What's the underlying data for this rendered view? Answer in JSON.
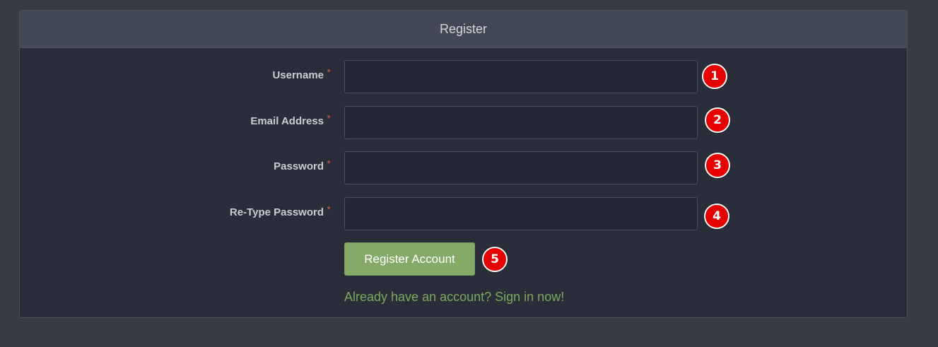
{
  "panel": {
    "title": "Register"
  },
  "form": {
    "fields": [
      {
        "label": "Username",
        "required_mark": "*",
        "value": "",
        "placeholder": "",
        "badge": "1"
      },
      {
        "label": "Email Address",
        "required_mark": "*",
        "value": "",
        "placeholder": "",
        "badge": "2"
      },
      {
        "label": "Password",
        "required_mark": "*",
        "value": "",
        "placeholder": "",
        "badge": "3"
      },
      {
        "label": "Re-Type Password",
        "required_mark": "*",
        "value": "",
        "placeholder": "",
        "badge": "4"
      }
    ],
    "submit_label": "Register Account",
    "submit_badge": "5",
    "signin_text": "Already have an account? Sign in now!"
  },
  "colors": {
    "page_bg": "#373a45",
    "panel_header_bg": "#434855",
    "panel_body_bg": "#2a2e3a",
    "input_bg": "#232733",
    "accent_green": "#85a966",
    "link_green": "#7fa85e",
    "required_red": "#d9534f",
    "badge_red": "#e60000"
  }
}
